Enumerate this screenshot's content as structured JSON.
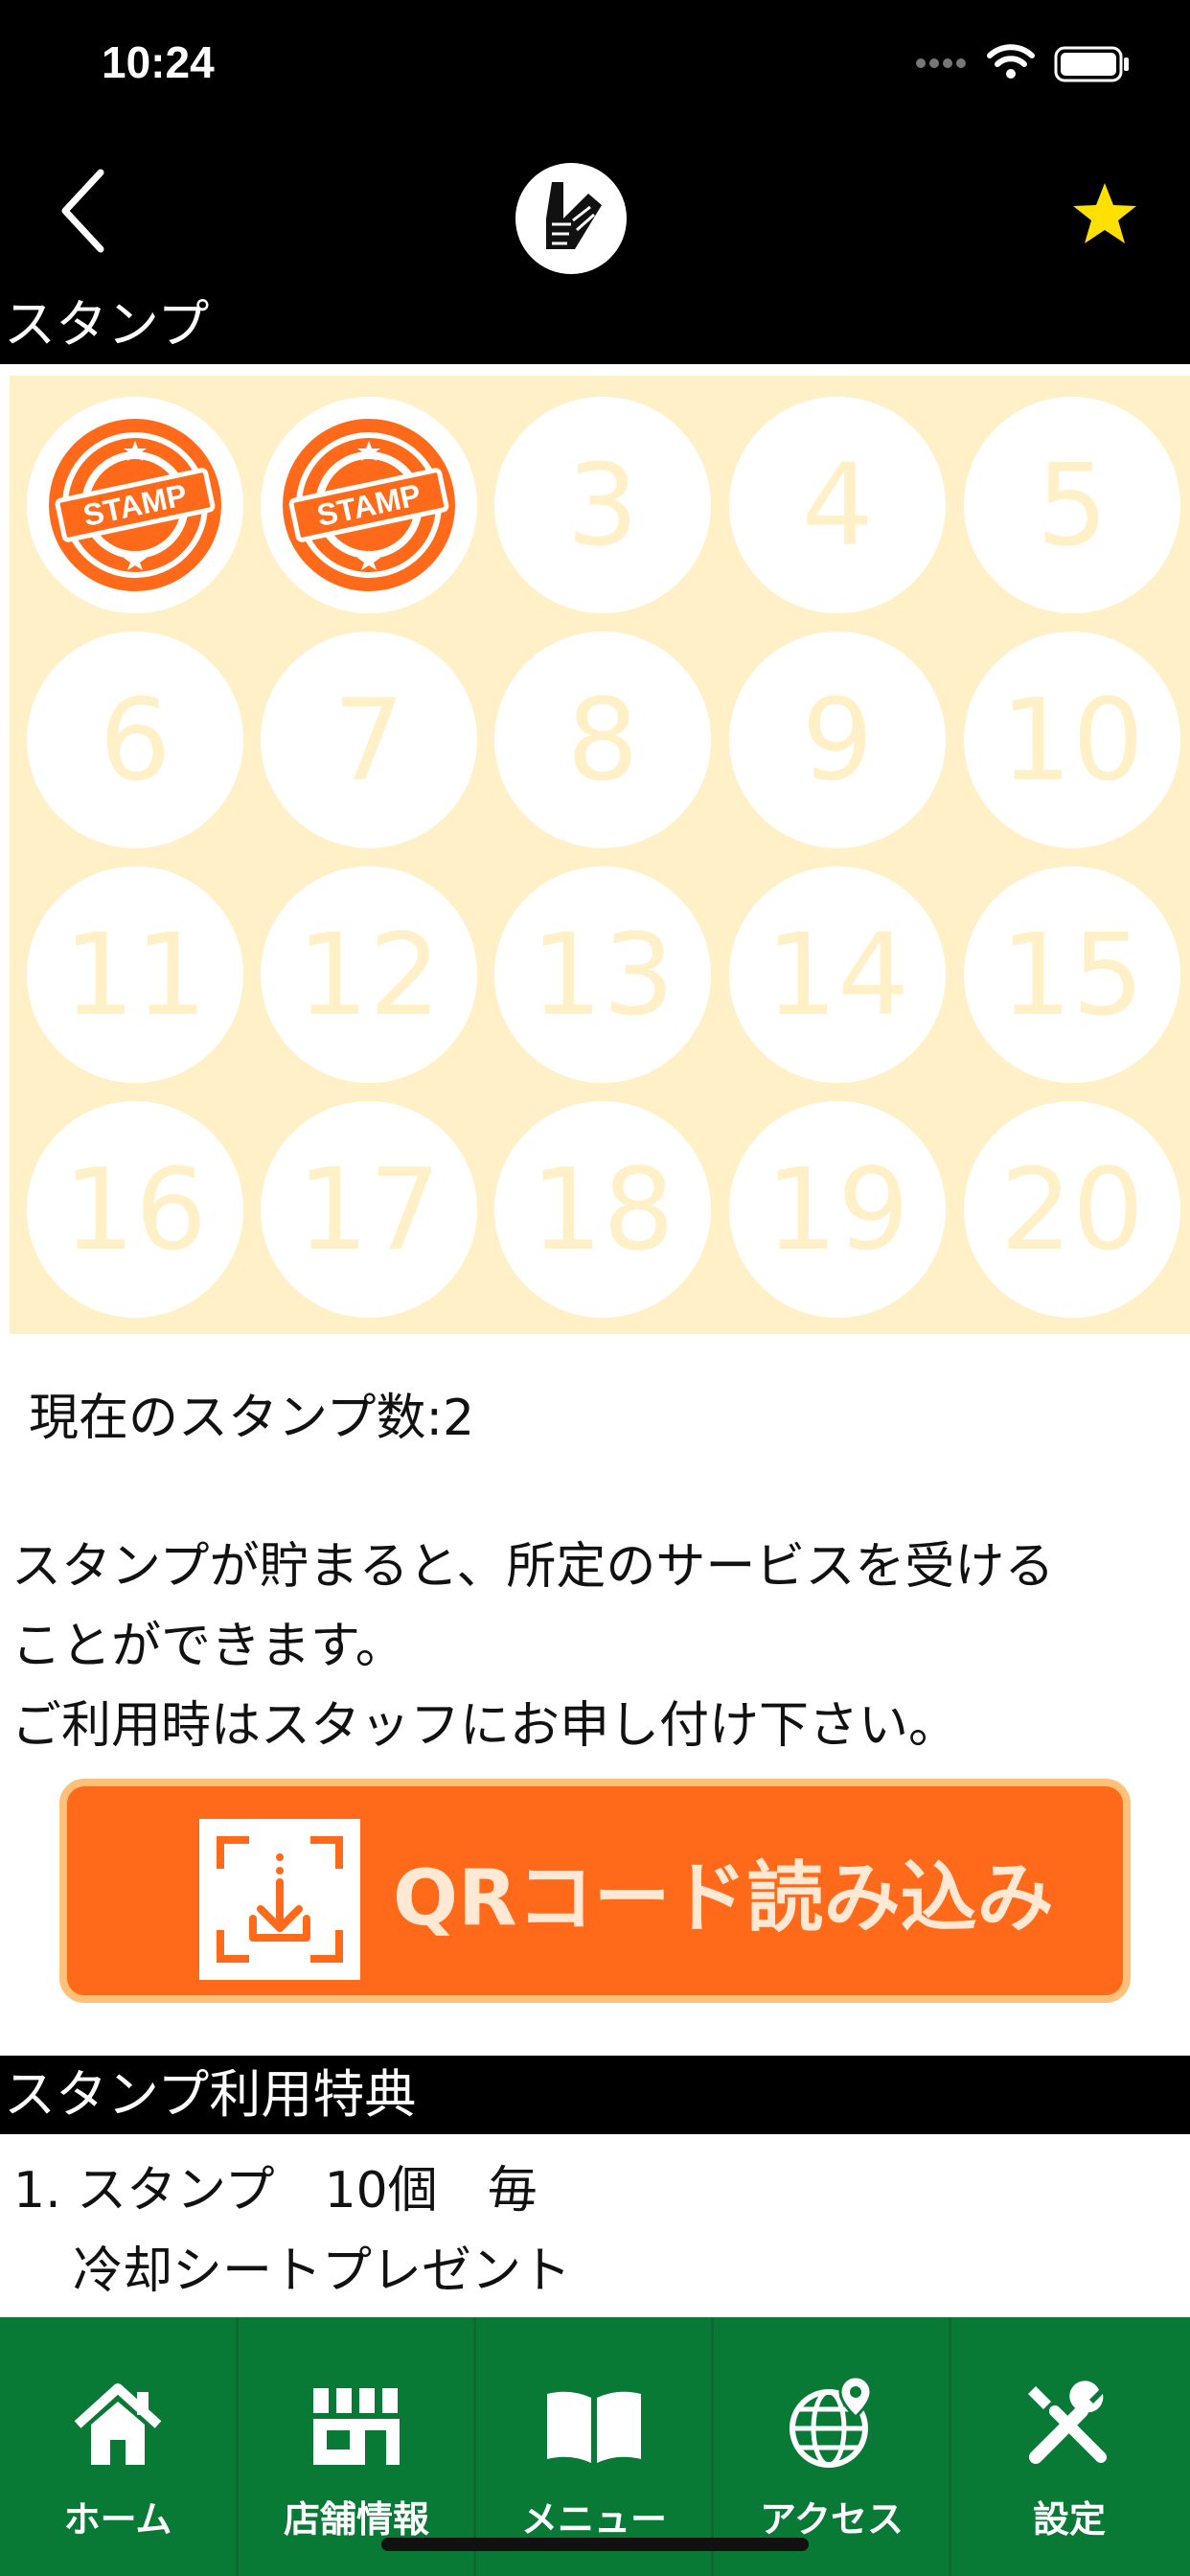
{
  "status": {
    "time": "10:24"
  },
  "nav": {
    "title": "スタンプ"
  },
  "stamp_card": {
    "stamped": [
      1,
      2
    ],
    "stamp_text": "STAMP",
    "slots": [
      "1",
      "2",
      "3",
      "4",
      "5",
      "6",
      "7",
      "8",
      "9",
      "10",
      "11",
      "12",
      "13",
      "14",
      "15",
      "16",
      "17",
      "18",
      "19",
      "20"
    ]
  },
  "info": {
    "count_label": "現在のスタンプ数:2",
    "description": [
      "スタンプが貯まると、所定のサービスを受ける",
      "ことができます。",
      "ご利用時はスタッフにお申し付け下さい。"
    ]
  },
  "qr_button": {
    "label": "QRコード読み込み"
  },
  "benefits": {
    "title": "スタンプ利用特典",
    "line1": "1. スタンプ　10個　毎",
    "line2": "冷却シートプレゼント"
  },
  "tabs": [
    {
      "label": "ホーム",
      "icon": "home-icon"
    },
    {
      "label": "店舗情報",
      "icon": "store-icon"
    },
    {
      "label": "メニュー",
      "icon": "book-icon"
    },
    {
      "label": "アクセス",
      "icon": "globe-pin-icon"
    },
    {
      "label": "設定",
      "icon": "tools-icon"
    }
  ],
  "colors": {
    "tab_bar": "#087a35",
    "accent_orange": "#ff6a1a",
    "card_bg": "#fff0c8",
    "favorite_star": "#ffe000"
  }
}
